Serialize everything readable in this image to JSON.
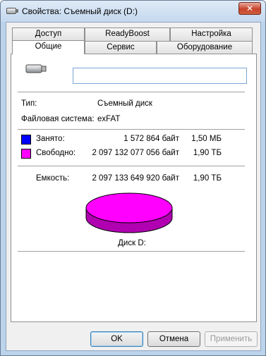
{
  "window": {
    "title": "Свойства: Съемный диск (D:)",
    "close_glyph": "✕"
  },
  "tabs": {
    "top_row": [
      "Доступ",
      "ReadyBoost",
      "Настройка"
    ],
    "bottom_row": [
      "Общие",
      "Сервис",
      "Оборудование"
    ],
    "active": "Общие"
  },
  "general": {
    "name_input_value": "",
    "type_label": "Тип:",
    "type_value": "Съемный диск",
    "fs_label": "Файловая система:",
    "fs_value": "exFAT",
    "used": {
      "label": "Занято:",
      "bytes": "1 572 864 байт",
      "human": "1,50 МБ",
      "color": "#0000ff"
    },
    "free": {
      "label": "Свободно:",
      "bytes": "2 097 132 077 056 байт",
      "human": "1,90 ТБ",
      "color": "#ff00ff"
    },
    "capacity": {
      "label": "Емкость:",
      "bytes": "2 097 133 649 920 байт",
      "human": "1,90 ТБ"
    },
    "disk_label": "Диск D:",
    "icons": {
      "drive": "removable-drive-icon"
    }
  },
  "buttons": {
    "ok": "OK",
    "cancel": "Отмена",
    "apply": "Применить"
  }
}
